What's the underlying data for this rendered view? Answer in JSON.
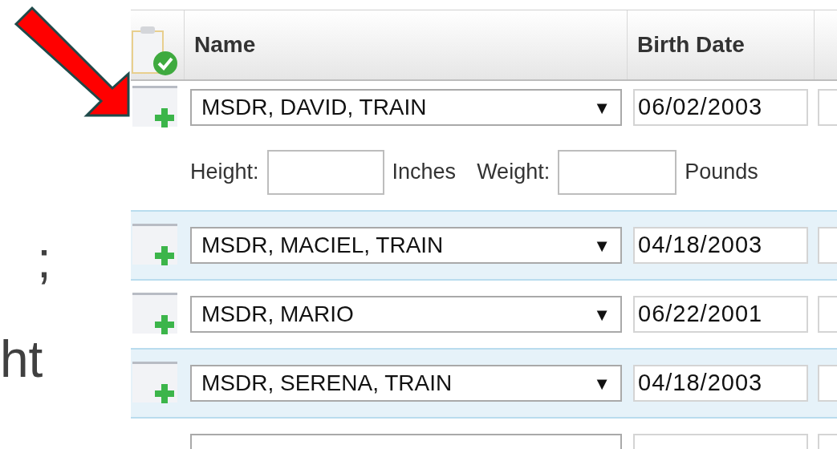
{
  "slide_text": [
    ";",
    "ht"
  ],
  "table": {
    "columns": [
      "Name",
      "Birth Date"
    ],
    "rows": [
      {
        "kind": "person",
        "name": "MSDR, DAVID, TRAIN",
        "arrow": "▼",
        "birth_date": "06/02/2003",
        "details": {
          "height_label": "Height:",
          "height_unit": "Inches",
          "weight_label": "Weight:",
          "weight_unit": "Pounds"
        }
      },
      {
        "kind": "person",
        "name": "MSDR, MACIEL, TRAIN",
        "arrow": "▼",
        "birth_date": "04/18/2003"
      },
      {
        "kind": "person",
        "name": "MSDR, MARIO",
        "arrow": "▼",
        "birth_date": "06/22/2001"
      },
      {
        "kind": "person",
        "name": "MSDR, SERENA, TRAIN",
        "arrow": "▼",
        "birth_date": "04/18/2003"
      },
      {
        "kind": "blank"
      }
    ]
  }
}
